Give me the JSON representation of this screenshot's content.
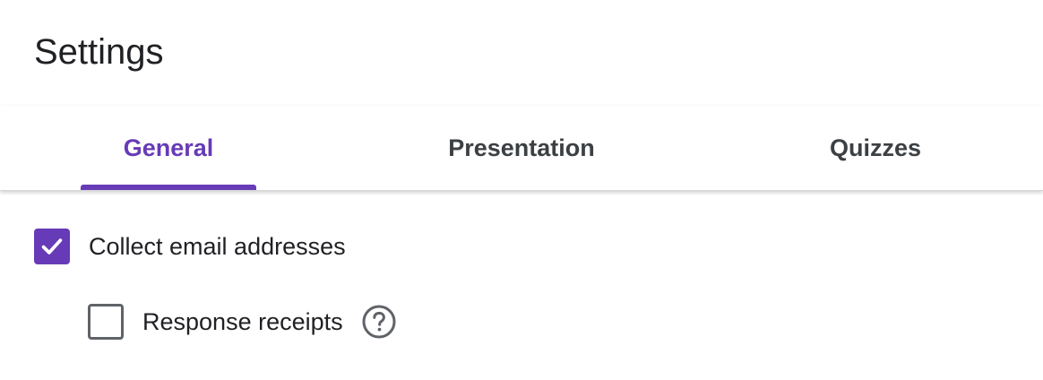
{
  "page": {
    "title": "Settings"
  },
  "tabs": [
    {
      "label": "General",
      "active": true
    },
    {
      "label": "Presentation",
      "active": false
    },
    {
      "label": "Quizzes",
      "active": false
    }
  ],
  "settings": {
    "collect_email": {
      "label": "Collect email addresses",
      "checked": true
    },
    "response_receipts": {
      "label": "Response receipts",
      "checked": false,
      "help_icon": "help-circle-icon"
    }
  },
  "colors": {
    "accent": "#673ab7",
    "text": "#202124",
    "secondary_text": "#3c4043",
    "checkbox_border": "#5f6368"
  }
}
